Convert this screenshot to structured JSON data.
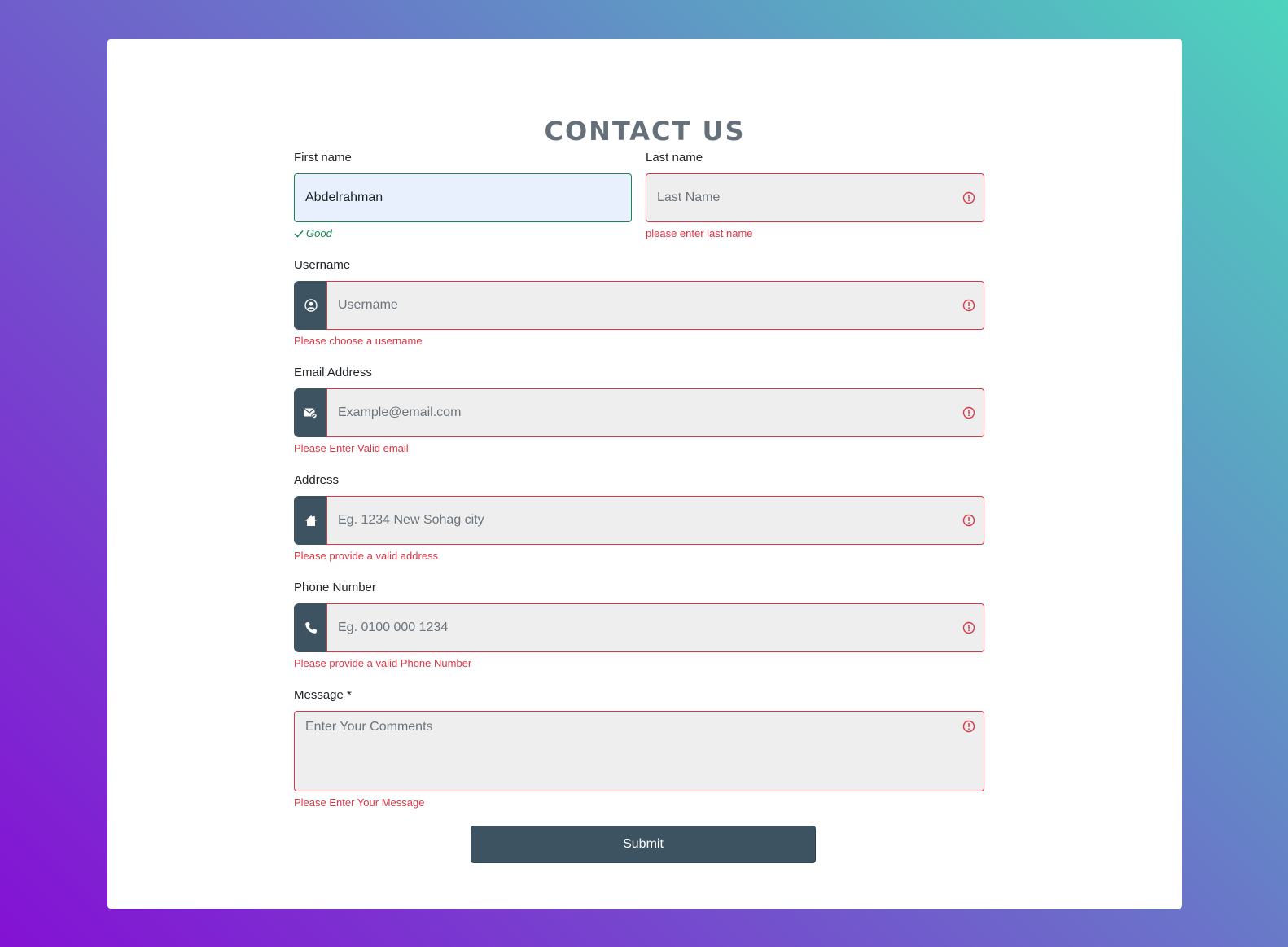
{
  "page": {
    "title": "CONTACT US",
    "colors": {
      "error": "#dc3545",
      "success": "#198754",
      "addon": "#3d5361",
      "title": "#65707a"
    }
  },
  "form": {
    "first_name": {
      "label": "First name",
      "value": "Abdelrahman",
      "feedback": "Good",
      "state": "valid"
    },
    "last_name": {
      "label": "Last name",
      "placeholder": "Last Name",
      "feedback": "please enter last name",
      "state": "invalid"
    },
    "username": {
      "label": "Username",
      "placeholder": "Username",
      "icon": "user-circle-icon",
      "feedback": "Please choose a username",
      "state": "invalid"
    },
    "email": {
      "label": "Email Address",
      "placeholder": "Example@email.com",
      "icon": "envelope-icon",
      "feedback": "Please Enter Valid email",
      "state": "invalid"
    },
    "address": {
      "label": "Address",
      "placeholder": "Eg. 1234 New Sohag city",
      "icon": "home-icon",
      "feedback": "Please provide a valid address",
      "state": "invalid"
    },
    "phone": {
      "label": "Phone Number",
      "placeholder": "Eg. 0100 000 1234",
      "icon": "phone-icon",
      "feedback": "Please provide a valid Phone Number",
      "state": "invalid"
    },
    "message": {
      "label": "Message *",
      "placeholder": "Enter Your Comments",
      "feedback": "Please Enter Your Message",
      "state": "invalid"
    },
    "submit_label": "Submit"
  }
}
